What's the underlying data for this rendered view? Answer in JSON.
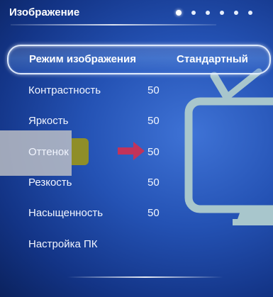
{
  "header": {
    "title": "Изображение",
    "pages": 6,
    "active_page": 1
  },
  "menu": {
    "selected": {
      "label": "Режим изображения",
      "value": "Стандартный"
    },
    "items": [
      {
        "label": "Контрастность",
        "value": "50"
      },
      {
        "label": "Яркость",
        "value": "50"
      },
      {
        "label": "Оттенок",
        "value": "50"
      },
      {
        "label": "Резкость",
        "value": "50"
      },
      {
        "label": "Насыщенность",
        "value": "50"
      },
      {
        "label": "Настройка ПК",
        "value": ""
      }
    ]
  },
  "icons": {
    "tv": "tv-icon",
    "pointer": "arrow-right-icon"
  },
  "colors": {
    "background": "#2452b4",
    "pointer": "#c2335a",
    "highlight_block": "#8f8e28",
    "tv_outline": "#a8c6cc"
  }
}
